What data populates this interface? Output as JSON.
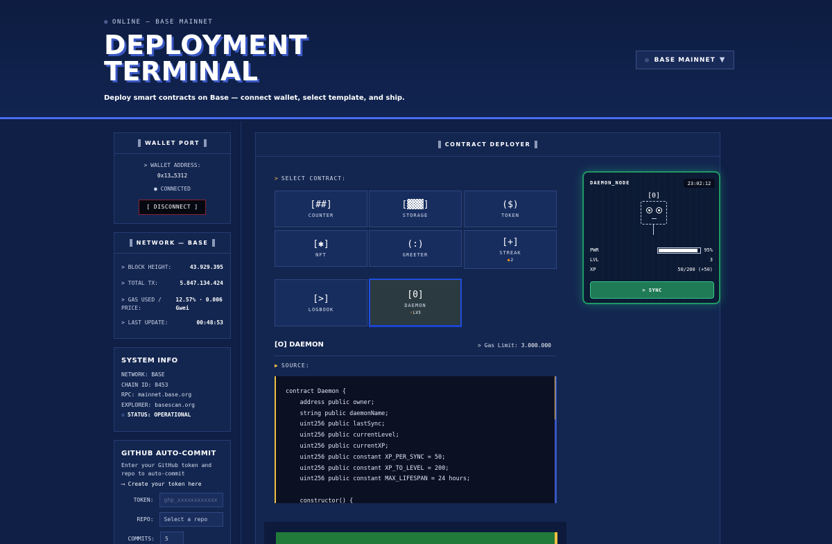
{
  "header": {
    "status": "ONLINE — BASE MAINNET",
    "title_line1": "DEPLOYMENT",
    "title_line2": "TERMINAL",
    "subtitle": "Deploy smart contracts on Base — connect wallet, select template, and ship.",
    "network_button": "BASE MAINNET",
    "network_caret": "▼"
  },
  "wallet": {
    "heading": "WALLET PORT",
    "address_label": "> WALLET ADDRESS:",
    "address": "0x13…5312",
    "status": "CONNECTED",
    "disconnect_label": "[ DISCONNECT ]"
  },
  "network": {
    "heading": "NETWORK — BASE",
    "rows": [
      {
        "label": "> BLOCK HEIGHT:",
        "value": "43.929.395"
      },
      {
        "label": "> TOTAL TX:",
        "value": "5.847.134.424"
      },
      {
        "label": "> GAS USED / PRICE:",
        "value": "12.57% · 0.006 Gwei"
      },
      {
        "label": "> LAST UPDATE:",
        "value": "00:48:53"
      }
    ]
  },
  "system_info": {
    "heading": "SYSTEM INFO",
    "lines": [
      "NETWORK:  BASE",
      "CHAIN ID:  8453",
      "RPC:  mainnet.base.org",
      "EXPLORER:  basescan.org"
    ],
    "status": "STATUS: OPERATIONAL"
  },
  "github": {
    "heading": "GITHUB AUTO-COMMIT",
    "description": "Enter your GitHub token and repo to auto-commit",
    "link": "⟶ Create your token here",
    "token_label": "TOKEN:",
    "token_placeholder": "ghp_xxxxxxxxxxxx",
    "repo_label": "REPO:",
    "repo_value": "Select a repo",
    "commits_label": "COMMITS:",
    "commits_value": "5"
  },
  "deployer": {
    "heading": "CONTRACT DEPLOYER",
    "select_label": "SELECT CONTRACT:",
    "tiles": [
      {
        "glyph": "[##]",
        "name": "COUNTER",
        "badge": ""
      },
      {
        "glyph": "[▓▓▓]",
        "name": "STORAGE",
        "badge": ""
      },
      {
        "glyph": "($)",
        "name": "TOKEN",
        "badge": ""
      },
      {
        "glyph": "[✱]",
        "name": "NFT",
        "badge": ""
      },
      {
        "glyph": "(:)",
        "name": "GREETER",
        "badge": ""
      },
      {
        "glyph": "[+]",
        "name": "STREAK",
        "badge": "2"
      },
      {
        "glyph": "[>]",
        "name": "LOGBOOK",
        "badge": ""
      },
      {
        "glyph": "[0]",
        "name": "DAEMON",
        "badge": "LV3"
      }
    ],
    "selected_title": "[O] DAEMON",
    "gas_limit_label": "> Gas Limit:",
    "gas_limit_value": "3.000.000",
    "source_label": "SOURCE:",
    "code_lines": [
      "contract Daemon {",
      "    address public owner;",
      "    string public daemonName;",
      "    uint256 public lastSync;",
      "    uint256 public currentLevel;",
      "    uint256 public currentXP;",
      "    uint256 public constant XP_PER_SYNC = 50;",
      "    uint256 public constant XP_TO_LEVEL = 200;",
      "    uint256 public constant MAX_LIFESPAN = 24 hours;",
      "",
      "    constructor() {"
    ]
  },
  "daemon_node": {
    "name": "DAEMON_NODE",
    "time": "23:02:12",
    "head": "[0]",
    "pwr_label": "PWR",
    "pwr_value": "95%",
    "pwr_fraction": 0.95,
    "lvl_label": "LVL",
    "lvl_value": "3",
    "xp_label": "XP",
    "xp_value": "50/200 (+50)",
    "sync_label": "> SYNC"
  },
  "colors": {
    "accent": "#4a6cf0",
    "highlight": "#f0c040",
    "node_green": "#1f9a64",
    "danger": "#8a2230"
  }
}
